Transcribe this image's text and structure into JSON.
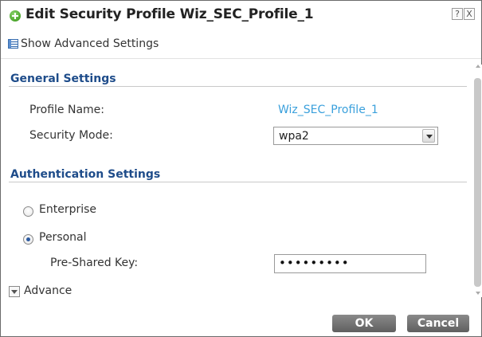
{
  "dialog": {
    "title": "Edit Security Profile Wiz_SEC_Profile_1",
    "help_glyph": "?",
    "close_glyph": "X"
  },
  "toolbar": {
    "show_advanced_label": "Show Advanced Settings"
  },
  "general_settings": {
    "heading": "General Settings",
    "profile_name_label": "Profile Name:",
    "profile_name_value": "Wiz_SEC_Profile_1",
    "security_mode_label": "Security Mode:",
    "security_mode_value": "wpa2"
  },
  "authentication_settings": {
    "heading": "Authentication Settings",
    "enterprise_label": "Enterprise",
    "enterprise_checked": false,
    "personal_label": "Personal",
    "personal_checked": true,
    "psk_label": "Pre-Shared Key:",
    "psk_value": "•••••••••",
    "advance_label": "Advance"
  },
  "footer": {
    "ok_label": "OK",
    "cancel_label": "Cancel"
  },
  "colors": {
    "section_heading": "#1e4c8a",
    "link": "#3aa0dc",
    "button": "#6e6e6e",
    "title_icon": "#4aa52a"
  },
  "icons": {
    "title": "green-plus-circle-icon",
    "advanced": "table-grid-icon",
    "advance_toggle": "triangle-down-icon"
  }
}
